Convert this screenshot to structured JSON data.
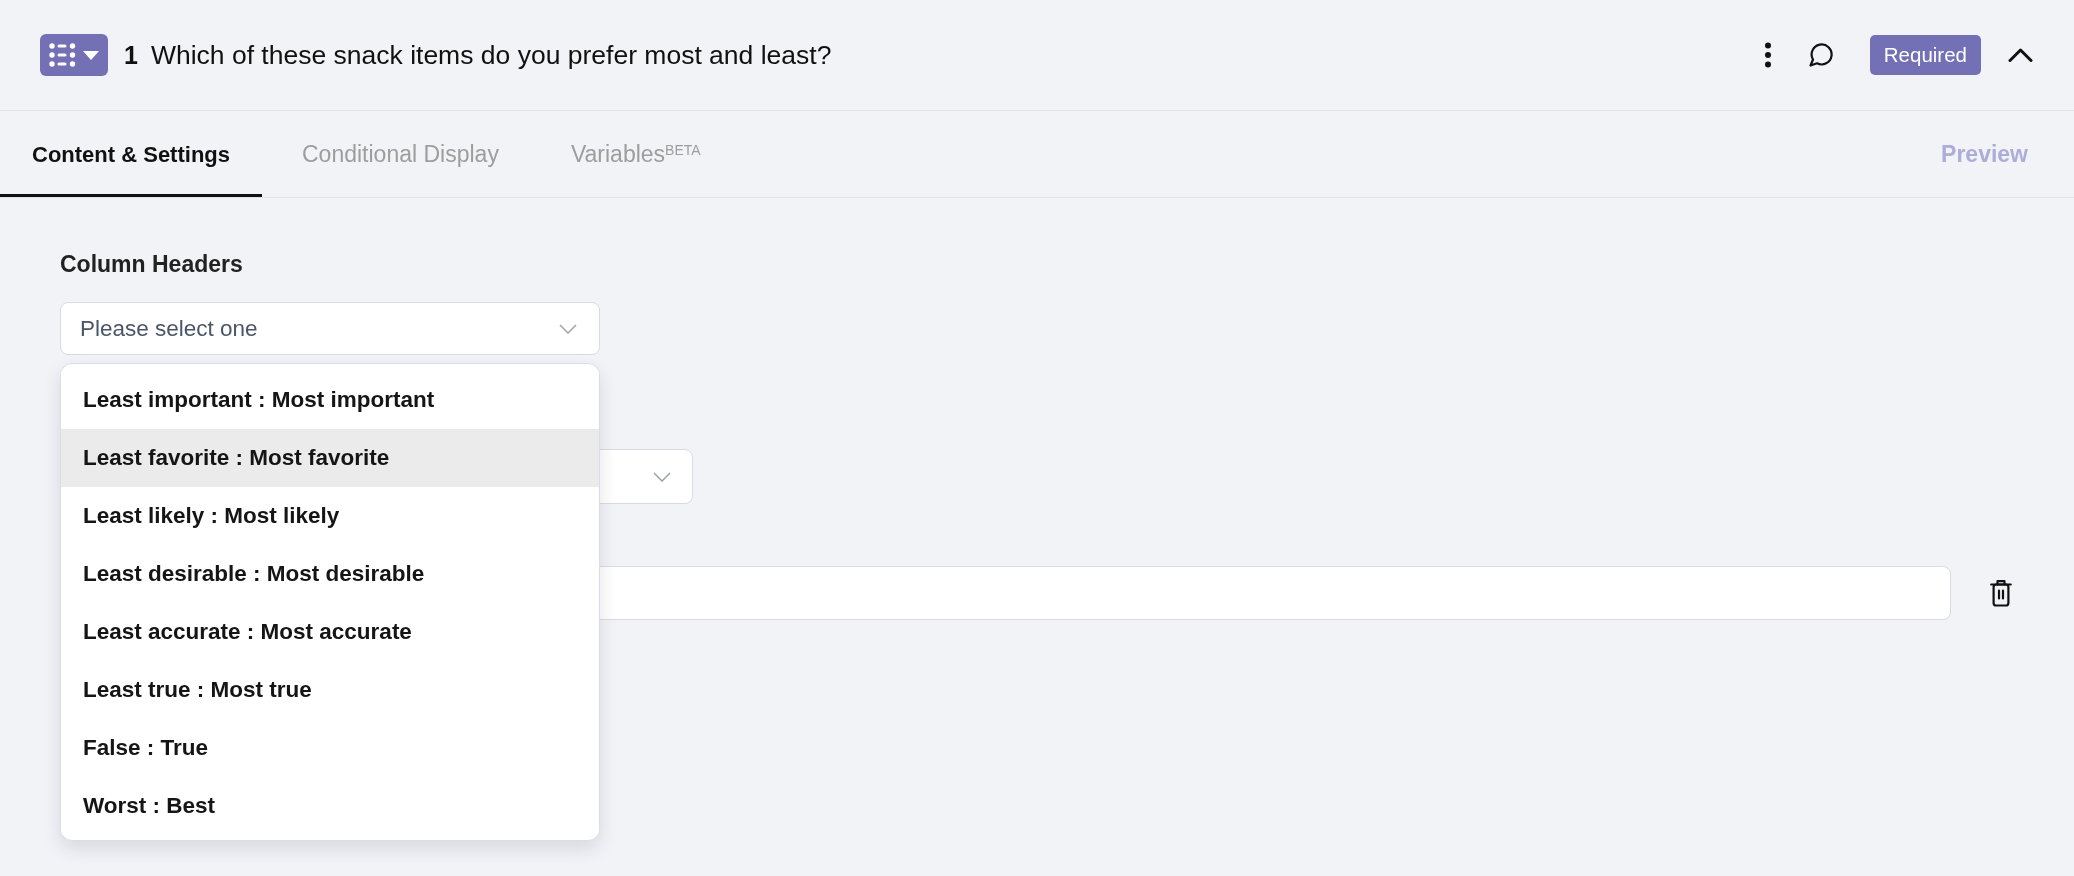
{
  "question": {
    "number": "1",
    "text": "Which of these snack items do you prefer most and least?",
    "required": {
      "label": "Required",
      "on": true
    },
    "expanded": true
  },
  "tabs": [
    {
      "label": "Content & Settings",
      "selected": true
    },
    {
      "label": "Conditional Display",
      "selected": false
    },
    {
      "label": "Variables$^{BETA}$",
      "selected": false
    }
  ],
  "preview": {
    "label": "Preview",
    "disabled": true
  },
  "column_headers": {
    "label": "Column Headers",
    "placeholder": "Please select one",
    "expanded": true,
    "options": [
      {
        "label": "Least important : Most important",
        "highlighted": false
      },
      {
        "label": "Least favorite : Most favorite",
        "highlighted": true
      },
      {
        "label": "Least likely : Most likely",
        "highlighted": false
      },
      {
        "label": "Least desirable : Most desirable",
        "highlighted": false
      },
      {
        "label": "Least accurate : Most accurate",
        "highlighted": false
      },
      {
        "label": "Least true : Most true",
        "highlighted": false
      },
      {
        "label": "False : True",
        "highlighted": false
      },
      {
        "label": "Worst : Best",
        "highlighted": false
      }
    ]
  },
  "fields": [
    {
      "kind": "select"
    },
    {
      "kind": "text",
      "removable": true
    }
  ]
}
